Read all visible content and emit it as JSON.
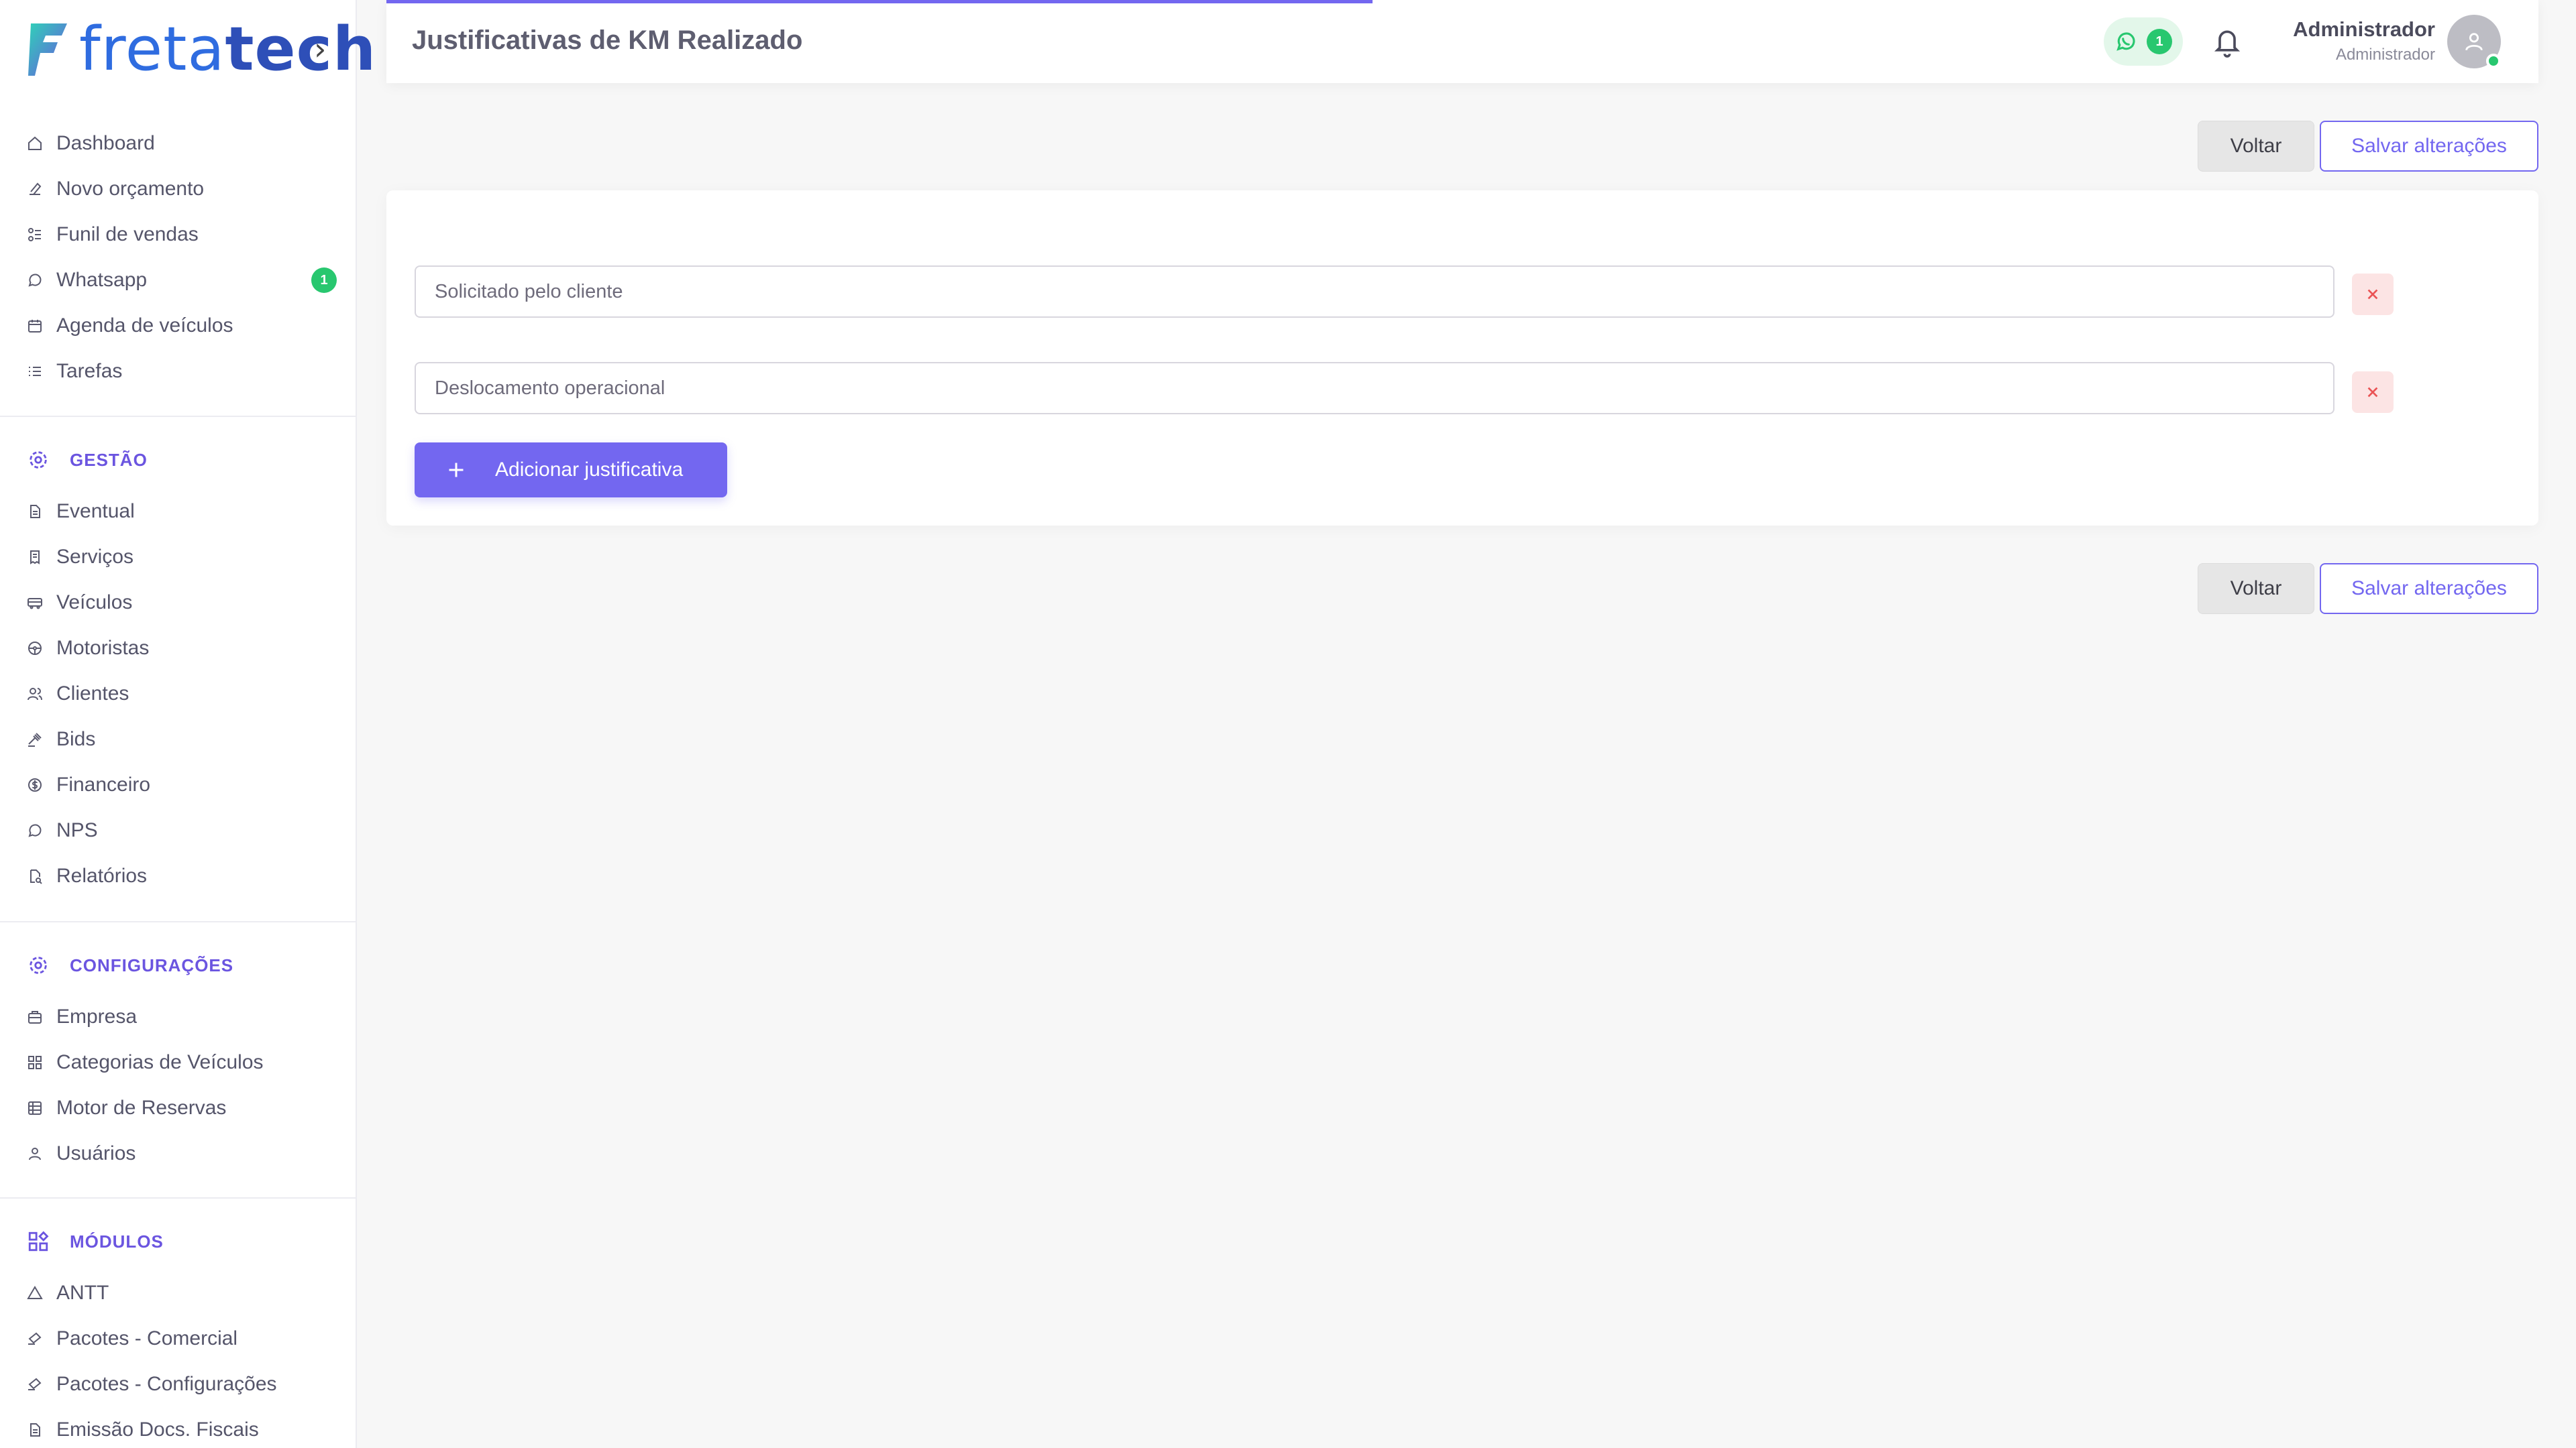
{
  "app": {
    "logo_text_light": "freta",
    "logo_text_bold": "tech",
    "logo_chevron": "›"
  },
  "sidebar": {
    "main_items": [
      {
        "label": "Dashboard",
        "icon": "home-icon"
      },
      {
        "label": "Novo orçamento",
        "icon": "edit-icon"
      },
      {
        "label": "Funil de vendas",
        "icon": "funnel-icon"
      },
      {
        "label": "Whatsapp",
        "icon": "whatsapp-icon",
        "badge": "1"
      },
      {
        "label": "Agenda de veículos",
        "icon": "calendar-icon"
      },
      {
        "label": "Tarefas",
        "icon": "list-icon"
      }
    ],
    "section_gestao": {
      "title": "GESTÃO",
      "icon": "gear-icon",
      "items": [
        {
          "label": "Eventual",
          "icon": "document-icon"
        },
        {
          "label": "Serviços",
          "icon": "receipt-icon"
        },
        {
          "label": "Veículos",
          "icon": "bus-icon"
        },
        {
          "label": "Motoristas",
          "icon": "steering-wheel-icon"
        },
        {
          "label": "Clientes",
          "icon": "users-icon"
        },
        {
          "label": "Bids",
          "icon": "gavel-icon"
        },
        {
          "label": "Financeiro",
          "icon": "dollar-icon"
        },
        {
          "label": "NPS",
          "icon": "chat-icon"
        },
        {
          "label": "Relatórios",
          "icon": "report-icon"
        }
      ]
    },
    "section_config": {
      "title": "CONFIGURAÇÕES",
      "icon": "gear-icon",
      "items": [
        {
          "label": "Empresa",
          "icon": "building-icon"
        },
        {
          "label": "Categorias de Veículos",
          "icon": "grid-icon"
        },
        {
          "label": "Motor de Reservas",
          "icon": "table-icon"
        },
        {
          "label": "Usuários",
          "icon": "user-icon"
        }
      ]
    },
    "section_modulos": {
      "title": "MÓDULOS",
      "icon": "modules-icon",
      "items": [
        {
          "label": "ANTT",
          "icon": "triangle-icon"
        },
        {
          "label": "Pacotes - Comercial",
          "icon": "package-icon"
        },
        {
          "label": "Pacotes - Configurações",
          "icon": "package-icon"
        },
        {
          "label": "Emissão Docs. Fiscais",
          "icon": "document-icon"
        }
      ]
    }
  },
  "header": {
    "title": "Justificativas de KM Realizado",
    "whatsapp_count": "1",
    "user_name": "Administrador",
    "user_role": "Administrador"
  },
  "actions": {
    "back_label": "Voltar",
    "save_label": "Salvar alterações"
  },
  "form": {
    "justificativas": [
      {
        "value": "Solicitado pelo cliente"
      },
      {
        "value": "Deslocamento operacional"
      }
    ],
    "add_label": "Adicionar justificativa"
  },
  "colors": {
    "accent": "#7367f0",
    "success": "#28c76f",
    "danger_bg": "#fce4e4",
    "danger": "#ea5455"
  }
}
